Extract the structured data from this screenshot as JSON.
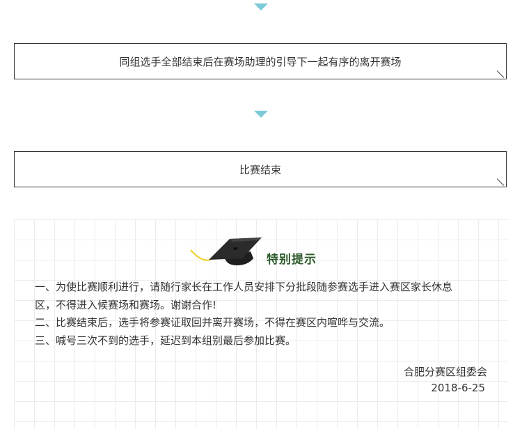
{
  "steps": [
    {
      "text": "同组选手全部结束后在赛场助理的引导下一起有序的离开赛场"
    },
    {
      "text": "比赛结束"
    }
  ],
  "notice": {
    "title": "特别提示",
    "icon": "graduation-cap-icon",
    "lines": [
      "一、为使比赛顺利进行，请随行家长在工作人员安排下分批段随参赛选手进入赛区家长休息",
      "区，不得进入候赛场和赛场。谢谢合作!",
      "二、比赛结束后，选手将参赛证取回并离开赛场，不得在赛区内喧哗与交流。",
      "三、喊号三次不到的选手，延迟到本组别最后参加比赛。"
    ],
    "organizer": "合肥分赛区组委会",
    "date": "2018-6-25"
  },
  "colors": {
    "arrow": "#7ccad6",
    "title": "#2b5a2b",
    "grid": "#ececec",
    "border": "#333333"
  }
}
